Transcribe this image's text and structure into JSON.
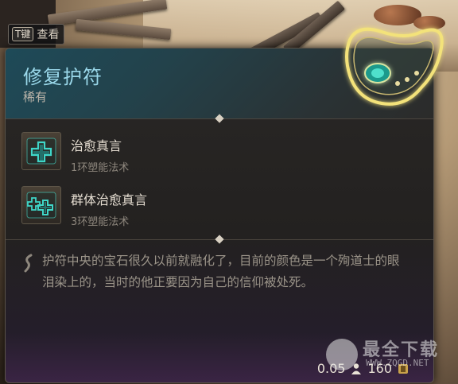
{
  "hotkey": {
    "key": "T键",
    "label": "查看"
  },
  "item": {
    "name": "修复护符",
    "rarity": "稀有"
  },
  "spells": [
    {
      "name": "治愈真言",
      "level": "1环塑能法术",
      "icon": "healing-word-icon"
    },
    {
      "name": "群体治愈真言",
      "level": "3环塑能法术",
      "icon": "mass-healing-word-icon"
    }
  ],
  "lore": "护符中央的宝石很久以前就融化了，目前的颜色是一个殉道士的眼泪染上的，当时的他正要因为自己的信仰被处死。",
  "footer": {
    "weight": "0.05",
    "value": "160"
  },
  "watermark": {
    "text": "最全下载",
    "url": "WWW.ZQGD.NET"
  },
  "colors": {
    "title": "#9ad8ea",
    "spell_glow": "#3fd6c8",
    "amulet_glow": "#f3e27a",
    "footer_gradient": "#3a2444"
  }
}
